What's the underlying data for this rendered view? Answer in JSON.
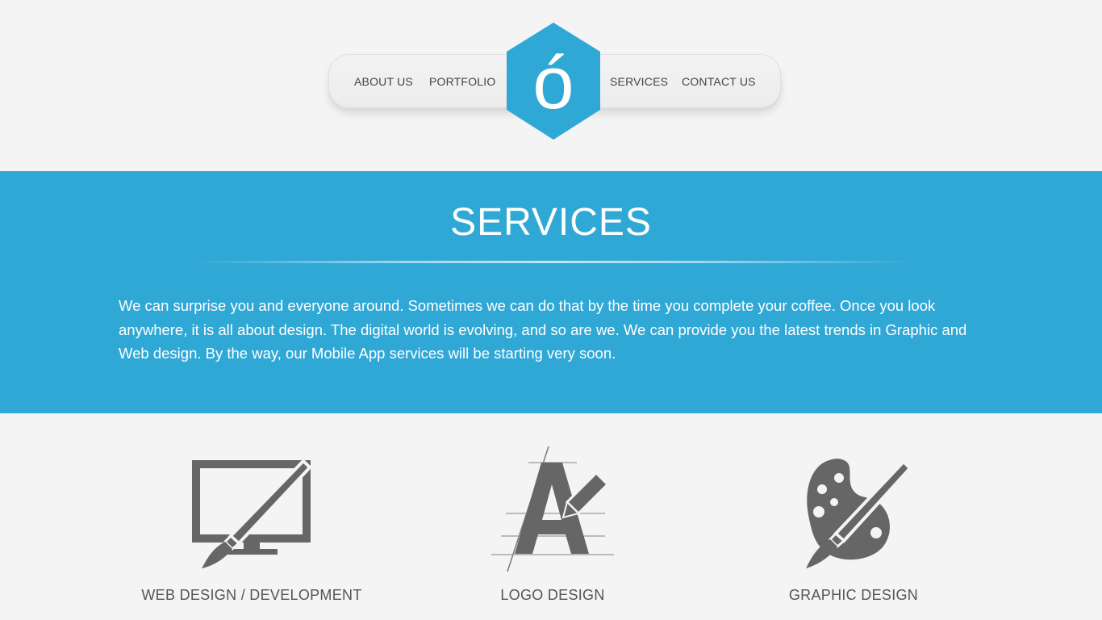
{
  "nav": {
    "items": [
      {
        "label": "ABOUT US"
      },
      {
        "label": "PORTFOLIO"
      },
      {
        "label": "SERVICES"
      },
      {
        "label": "CONTACT US"
      }
    ],
    "logo": {
      "glyph": "ó",
      "icon": "hexagon-logo-icon"
    }
  },
  "services_section": {
    "title": "SERVICES",
    "description": "We can surprise you and everyone around. Sometimes we can do that by the time you complete your coffee. Once you look anywhere, it is all about design. The digital world is evolving, and so are we. We can provide you the latest trends in Graphic and Web design. By the way, our Mobile App services will be starting very soon."
  },
  "services": [
    {
      "label": "WEB DESIGN / DEVELOPMENT",
      "icon": "monitor-brush-icon"
    },
    {
      "label": "LOGO DESIGN",
      "icon": "letter-a-pencil-icon"
    },
    {
      "label": "GRAPHIC DESIGN",
      "icon": "palette-brush-icon"
    }
  ],
  "colors": {
    "accent": "#30a8d6",
    "page_background": "#f4f4f4",
    "icon_gray": "#666666",
    "nav_text": "#444444"
  }
}
